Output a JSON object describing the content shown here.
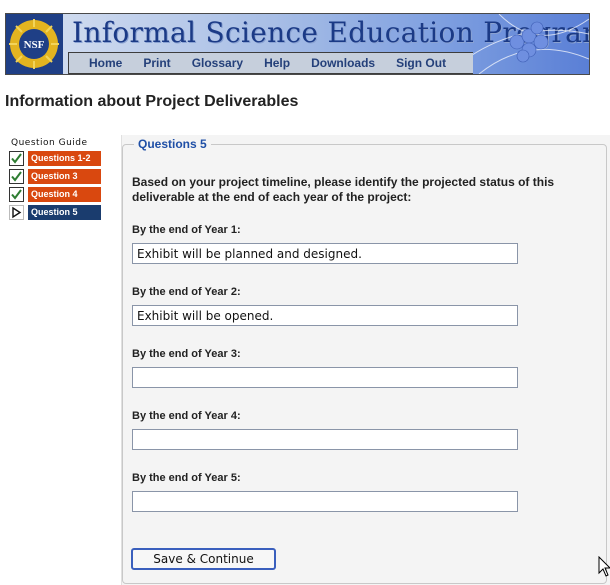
{
  "banner": {
    "title": "Informal Science Education Program",
    "logo_text": "NSF",
    "nav": [
      "Home",
      "Print",
      "Glossary",
      "Help",
      "Downloads",
      "Sign Out"
    ],
    "colors": {
      "title": "#1b3a86",
      "nav_bar": "#c6cfdc"
    }
  },
  "page": {
    "title": "Information about Project Deliverables"
  },
  "guide": {
    "title": "Question Guide",
    "items": [
      {
        "label": "Questions 1-2",
        "state": "checked",
        "icon": "checkbox-checked-icon",
        "color": "#d9480f"
      },
      {
        "label": "Question 3",
        "state": "checked",
        "icon": "checkbox-checked-icon",
        "color": "#d9480f"
      },
      {
        "label": "Question 4",
        "state": "checked",
        "icon": "checkbox-checked-icon",
        "color": "#d9480f"
      },
      {
        "label": "Question 5",
        "state": "current",
        "icon": "arrow-right-icon",
        "color": "#1a3c6e"
      }
    ]
  },
  "form": {
    "legend": "Questions 5",
    "intro": "Based on your project timeline, please identify the projected status of this deliverable at the end of each year of the project:",
    "fields": [
      {
        "label": "By the end of Year 1:",
        "value": "Exhibit will be planned and designed."
      },
      {
        "label": "By the end of Year 2:",
        "value": "Exhibit will be opened."
      },
      {
        "label": "By the end of Year 3:",
        "value": ""
      },
      {
        "label": "By the end of Year 4:",
        "value": ""
      },
      {
        "label": "By the end of Year 5:",
        "value": ""
      }
    ],
    "submit_label": "Save & Continue"
  }
}
